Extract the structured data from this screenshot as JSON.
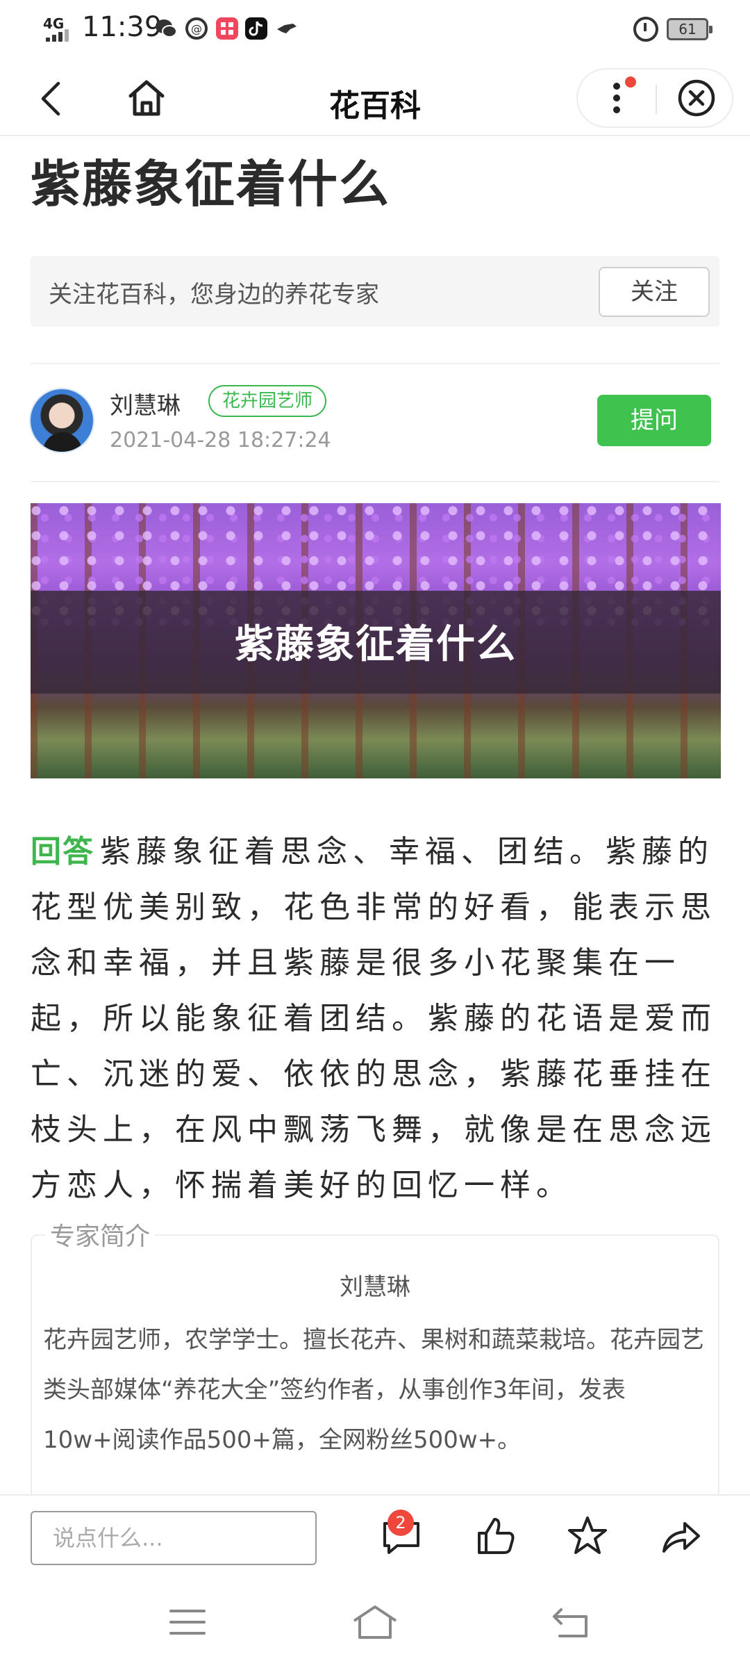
{
  "status_bar": {
    "network": "4G",
    "time": "11:39",
    "battery": "61",
    "app_icons": [
      "wechat-icon",
      "at-icon",
      "xiaohongshu-icon",
      "tiktok-icon",
      "pigeon-icon"
    ]
  },
  "title_bar": {
    "title": "花百科"
  },
  "article": {
    "title": "紫藤象征着什么",
    "follow_text": "关注花百科，您身边的养花专家",
    "follow_button": "关注",
    "author_name": "刘慧琳",
    "author_tag": "花卉园艺师",
    "date": "2021-04-28 18:27:24",
    "ask_button": "提问",
    "image_caption": "紫藤象征着什么",
    "answer_label": "回答",
    "answer_text": "紫藤象征着思念、幸福、团结。紫藤的花型优美别致，花色非常的好看，能表示思念和幸福，并且紫藤是很多小花聚集在一起，所以能象征着团结。紫藤的花语是爱而亡、沉迷的爱、依依的思念，紫藤花垂挂在枝头上，在风中飘荡飞舞，就像是在思念远方恋人，怀揣着美好的回忆一样。"
  },
  "expert": {
    "legend": "专家简介",
    "name": "刘慧琳",
    "bio": "花卉园艺师，农学学士。擅长花卉、果树和蔬菜栽培。花卉园艺类头部媒体“养花大全”签约作者，从事创作3年间，发表10w+阅读作品500+篇，全网粉丝500w+。"
  },
  "bottom_bar": {
    "comment_placeholder": "说点什么...",
    "comment_count": "2"
  },
  "colors": {
    "accent_green": "#3fc24e",
    "badge_red": "#f0473c"
  }
}
